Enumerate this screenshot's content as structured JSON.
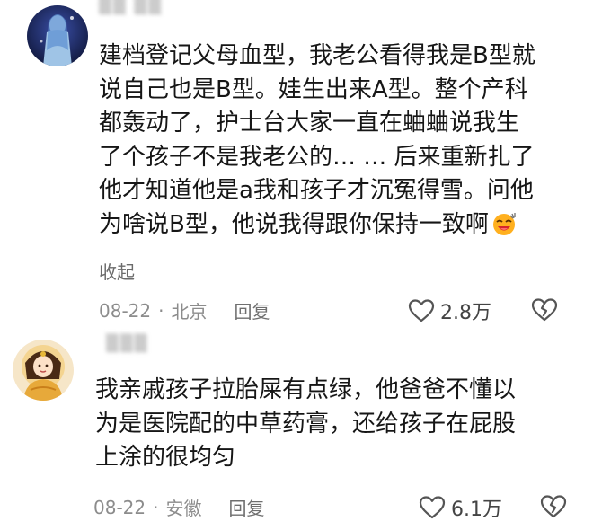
{
  "comments": [
    {
      "text": "建档登记父母血型，我老公看得我是B型就\n说自己也是B型。娃生出来A型。整个产科\n都轰动了，护士台大家一直在蛐蛐说我生\n了个孩子不是我老公的… … 后来重新扎了\n他才知道他是a我和孩子才沉冤得雪。问他\n为啥说B型，他说我得跟你保持一致啊",
      "collapse_label": "收起",
      "date": "08-22",
      "separator": "·",
      "location": "北京",
      "reply_label": "回复",
      "likes": "2.8万",
      "emoji": "laughing-face-icon"
    },
    {
      "text": "我亲戚孩子拉胎屎有点绿，他爸爸不懂以\n为是医院配的中草药膏，还给孩子在屁股\n上涂的很均匀",
      "date": "08-22",
      "separator": "·",
      "location": "安徽",
      "reply_label": "回复",
      "likes": "6.1万"
    }
  ],
  "colors": {
    "meta_text": "#8c8c8c",
    "body_text": "#161616",
    "icon_stroke": "#555555"
  }
}
